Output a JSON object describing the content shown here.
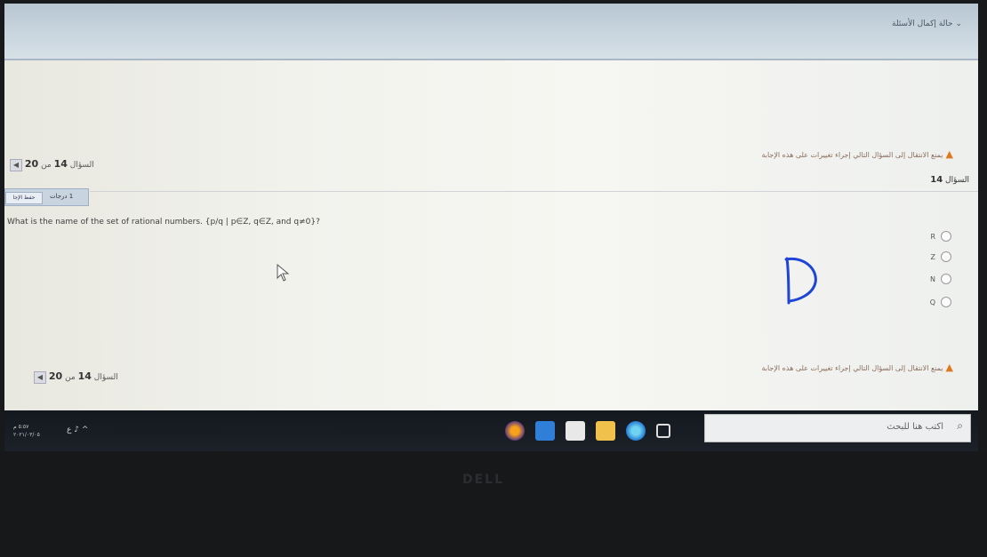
{
  "header": {
    "section_label": "حالة إكمال الأسئلة"
  },
  "warning": {
    "top_text": "يمنع الانتقال إلى السؤال التالي إجراء تغييرات على هذه الإجابة",
    "bottom_text": "يمنع الانتقال إلى السؤال التالي إجراء تغييرات على هذه الإجابة"
  },
  "navigation": {
    "top": {
      "prefix": "السؤال",
      "current": "14",
      "sep": "من",
      "total": "20"
    },
    "bottom": {
      "prefix": "السؤال",
      "current": "14",
      "sep": "من",
      "total": "20"
    }
  },
  "question": {
    "heading_prefix": "السؤال",
    "number": "14",
    "points_label": "1 درجات",
    "flag_label": "حفظ الإجا",
    "text": "What is the name of the set of rational numbers. {p/q | p∈Z, q∈Z, and q≠0}?",
    "options": [
      {
        "label": "R"
      },
      {
        "label": "Z"
      },
      {
        "label": "N"
      },
      {
        "label": "Q"
      }
    ],
    "handwritten_mark": "D"
  },
  "taskbar": {
    "search_placeholder": "اكتب هنا للبحث",
    "time": "٥:٥٧ م",
    "date": "٢٠٢١/٠٣/٠٥",
    "lang": "ع",
    "app_icons": [
      "firefox-icon",
      "mail-icon",
      "store-icon",
      "explorer-icon",
      "edge-icon",
      "task-view-icon"
    ]
  },
  "laptop": {
    "brand": "DELL"
  },
  "colors": {
    "topbar": "#c9d6df",
    "warning": "#e07820",
    "taskbar": "#1c2028",
    "ink": "#1f44d6"
  }
}
